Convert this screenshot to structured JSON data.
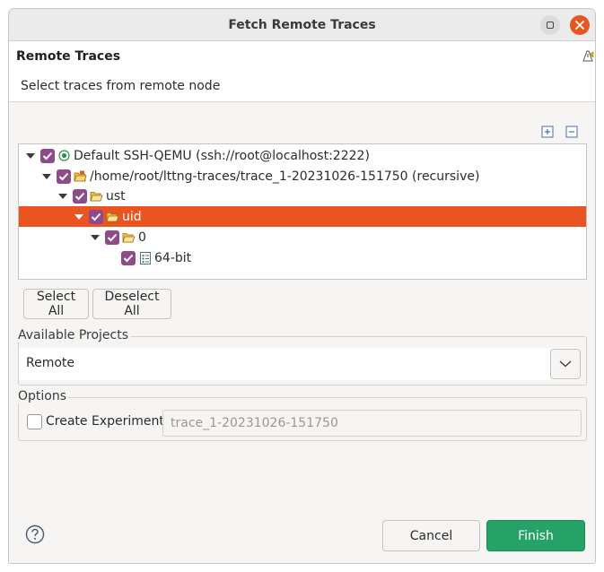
{
  "window": {
    "title": "Fetch Remote Traces"
  },
  "header": {
    "title": "Remote Traces",
    "description": "Select traces from remote node"
  },
  "tree": {
    "nodes": [
      {
        "label": "Default SSH-QEMU (ssh://root@localhost:2222)",
        "icon": "remote-node-icon",
        "checked": true,
        "expanded": true
      },
      {
        "label": "/home/root/lttng-traces/trace_1-20231026-151750 (recursive)",
        "icon": "trace-group-folder-icon",
        "checked": true,
        "expanded": true
      },
      {
        "label": "ust",
        "icon": "folder-open-icon",
        "checked": true,
        "expanded": true
      },
      {
        "label": "uid",
        "icon": "folder-open-icon",
        "checked": true,
        "expanded": true,
        "selected": true
      },
      {
        "label": "0",
        "icon": "folder-open-icon",
        "checked": true,
        "expanded": true
      },
      {
        "label": "64-bit",
        "icon": "trace-file-icon",
        "checked": true
      }
    ]
  },
  "buttons": {
    "select_all": "Select All",
    "deselect_all": "Deselect All",
    "cancel": "Cancel",
    "finish": "Finish"
  },
  "projects": {
    "group_label": "Available Projects",
    "selected": "Remote"
  },
  "options": {
    "group_label": "Options",
    "create_experiment_label": "Create Experiment",
    "create_experiment_checked": false,
    "experiment_name": "trace_1-20231026-151750"
  },
  "colors": {
    "selection": "#e95420",
    "checkbox": "#8e4b8a",
    "finish": "#26a269",
    "close": "#e95420"
  }
}
